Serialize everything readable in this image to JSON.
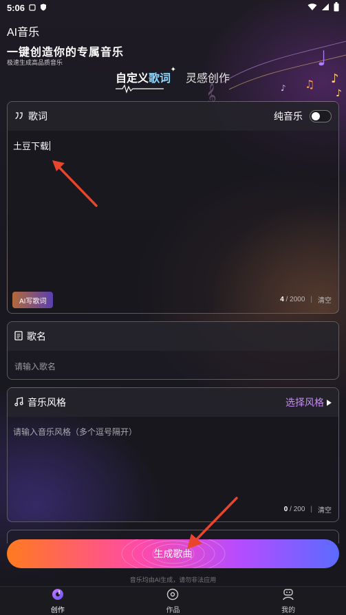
{
  "status_bar": {
    "time": "5:06"
  },
  "header": {
    "app_title": "AI音乐",
    "headline": "一键创造你的专属音乐",
    "subline": "极速生成高品质音乐"
  },
  "tabs": [
    {
      "label_prefix": "自定义",
      "label_highlight": "歌词",
      "active": true
    },
    {
      "label": "灵感创作",
      "active": false
    }
  ],
  "lyrics_card": {
    "title": "歌词",
    "toggle_label": "纯音乐",
    "content": "土豆下载",
    "ai_button": "AI写歌词",
    "count": "4",
    "max": "/ 2000",
    "clear": "清空"
  },
  "name_card": {
    "title": "歌名",
    "placeholder": "请输入歌名"
  },
  "style_card": {
    "title": "音乐风格",
    "select_label": "选择风格",
    "placeholder": "请输入音乐风格（多个逗号隔开）",
    "count": "0",
    "max": "/ 200",
    "clear": "清空"
  },
  "generate_button": "生成歌曲",
  "disclaimer": "音乐均由AI生成，请勿非法应用",
  "bottom_nav": [
    {
      "label": "创作",
      "icon": "music-disc-icon",
      "active": true
    },
    {
      "label": "作品",
      "icon": "record-icon",
      "active": false
    },
    {
      "label": "我的",
      "icon": "profile-icon",
      "active": false
    }
  ],
  "colors": {
    "accent_purple": "#c58cf2",
    "arrow_red": "#e8452c"
  }
}
